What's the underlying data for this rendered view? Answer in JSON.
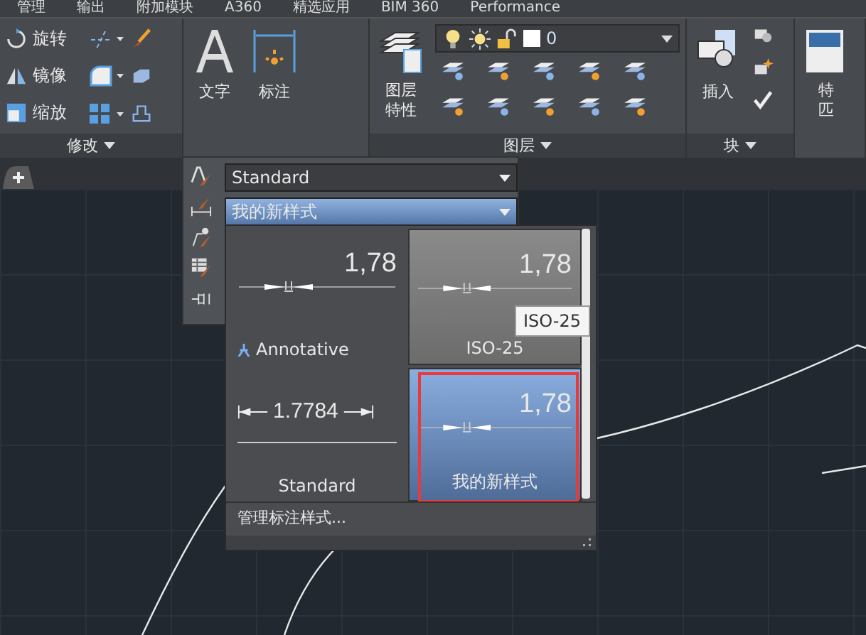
{
  "menu_tabs": [
    "管理",
    "输出",
    "附加模块",
    "A360",
    "精选应用",
    "BIM 360",
    "Performance"
  ],
  "modify_panel": {
    "title": "修改",
    "tools": [
      {
        "label": "旋转",
        "kind": "rotate"
      },
      {
        "label": "镜像",
        "kind": "mirror"
      },
      {
        "label": "缩放",
        "kind": "scale"
      }
    ]
  },
  "annotation_panel": {
    "buttons": [
      {
        "label": "文字",
        "kind": "text"
      },
      {
        "label": "标注",
        "kind": "dimension"
      }
    ]
  },
  "layers_panel": {
    "title": "图层",
    "button": "图层特性",
    "layer_combo": {
      "value": "0"
    }
  },
  "block_panel": {
    "title": "块",
    "button": "插入"
  },
  "properties_panel": {
    "label_lines": [
      "特",
      "匹"
    ]
  },
  "annotation_dropdown": {
    "combos": [
      {
        "value": "Standard",
        "open": false
      },
      {
        "value": "我的新样式",
        "open": true
      }
    ]
  },
  "dim_style_gallery": {
    "items": [
      {
        "name": "Annotative",
        "sample": "1,78",
        "kind": "metric",
        "annotative": true,
        "hovered": false,
        "selected": false
      },
      {
        "name": "ISO-25",
        "sample": "1,78",
        "kind": "metric",
        "annotative": false,
        "hovered": true,
        "selected": false
      },
      {
        "name": "Standard",
        "sample": "1.7784",
        "kind": "decimal",
        "annotative": false,
        "hovered": false,
        "selected": false
      },
      {
        "name": "我的新样式",
        "sample": "1,78",
        "kind": "metric",
        "annotative": false,
        "hovered": false,
        "selected": true
      }
    ],
    "footer": "管理标注样式...",
    "tooltip": "ISO-25"
  }
}
